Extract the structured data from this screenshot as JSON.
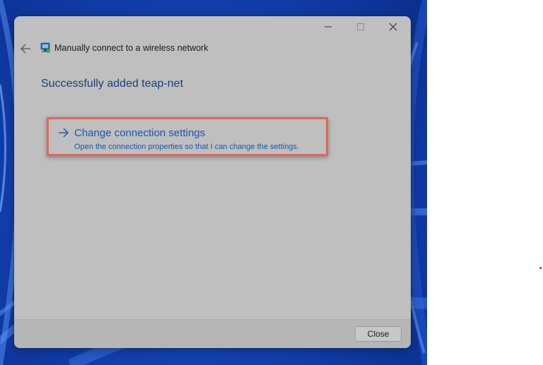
{
  "dialog": {
    "nav_title": "Manually connect to a wireless network",
    "heading": "Successfully added teap-net",
    "option": {
      "title": "Change connection settings",
      "description": "Open the connection properties so that I can change the settings."
    },
    "close_button_label": "Close"
  },
  "colors": {
    "dialog_background": "#bfbfbf",
    "heading_text": "#1c3f7a",
    "link_text": "#1a55a8",
    "highlight_border": "#e0675a",
    "wallpaper_blue": "#1444b8"
  },
  "icons": {
    "window_controls": [
      "minimize-icon",
      "maximize-icon",
      "close-icon"
    ],
    "navigation": [
      "back-arrow-icon",
      "network-icon"
    ],
    "option": "right-arrow-icon"
  }
}
